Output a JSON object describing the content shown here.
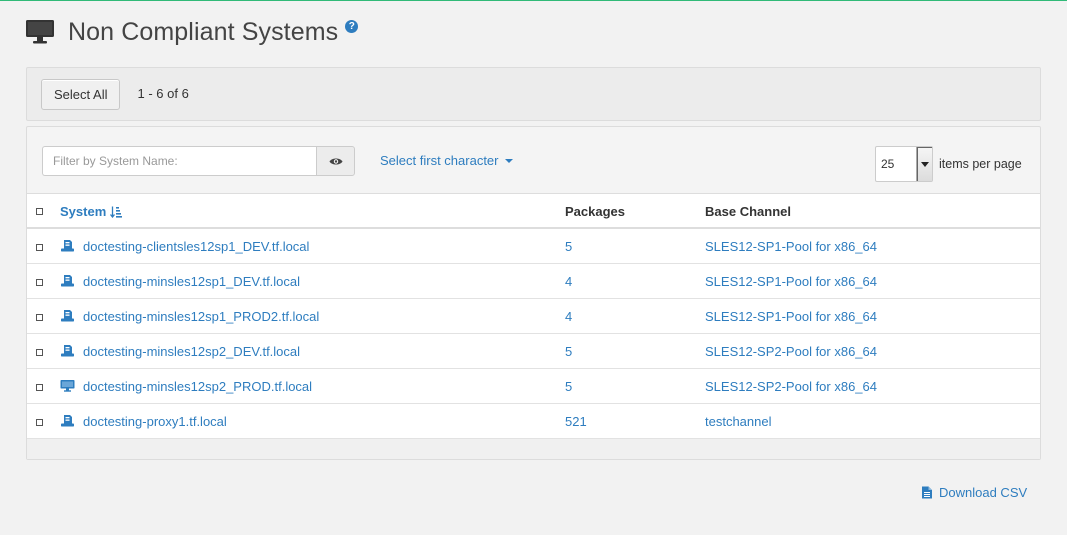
{
  "header": {
    "title": "Non Compliant Systems",
    "help_label": "?"
  },
  "toolbar": {
    "select_all_label": "Select All",
    "range_text": "1 - 6 of 6"
  },
  "filter": {
    "placeholder": "Filter by System Name:",
    "first_char_label": "Select first character",
    "page_size": "25",
    "per_page_label": "items per page"
  },
  "table": {
    "columns": {
      "system": "System",
      "packages": "Packages",
      "base_channel": "Base Channel"
    },
    "rows": [
      {
        "system": "doctesting-clientsles12sp1_DEV.tf.local",
        "packages": "5",
        "base_channel": "SLES12-SP1-Pool for x86_64",
        "icon": "server-icon"
      },
      {
        "system": "doctesting-minsles12sp1_DEV.tf.local",
        "packages": "4",
        "base_channel": "SLES12-SP1-Pool for x86_64",
        "icon": "server-icon"
      },
      {
        "system": "doctesting-minsles12sp1_PROD2.tf.local",
        "packages": "4",
        "base_channel": "SLES12-SP1-Pool for x86_64",
        "icon": "server-icon"
      },
      {
        "system": "doctesting-minsles12sp2_DEV.tf.local",
        "packages": "5",
        "base_channel": "SLES12-SP2-Pool for x86_64",
        "icon": "server-icon"
      },
      {
        "system": "doctesting-minsles12sp2_PROD.tf.local",
        "packages": "5",
        "base_channel": "SLES12-SP2-Pool for x86_64",
        "icon": "desktop-icon"
      },
      {
        "system": "doctesting-proxy1.tf.local",
        "packages": "521",
        "base_channel": "testchannel",
        "icon": "server-icon"
      }
    ]
  },
  "footer": {
    "download_label": "Download CSV"
  },
  "colors": {
    "accent": "#30ba78",
    "link": "#2e7dbf"
  }
}
